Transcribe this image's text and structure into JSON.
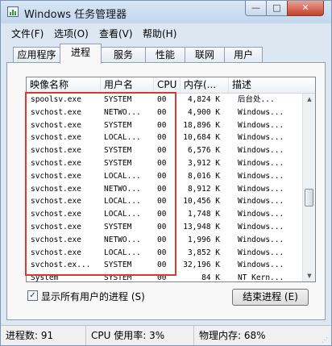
{
  "window": {
    "title": "Windows 任务管理器"
  },
  "title_buttons": {
    "minimize": "—",
    "maximize": "□",
    "close": "✕"
  },
  "menu": [
    "文件(F)",
    "选项(O)",
    "查看(V)",
    "帮助(H)"
  ],
  "tabs": [
    "应用程序",
    "进程",
    "服务",
    "性能",
    "联网",
    "用户"
  ],
  "active_tab": "进程",
  "columns": [
    "映像名称",
    "用户名",
    "CPU",
    "内存(...",
    "描述"
  ],
  "processes": [
    {
      "name": "spoolsv.exe",
      "user": "SYSTEM",
      "cpu": "00",
      "mem": "4,824 K",
      "desc": "后台处..."
    },
    {
      "name": "svchost.exe",
      "user": "NETWO...",
      "cpu": "00",
      "mem": "4,900 K",
      "desc": "Windows..."
    },
    {
      "name": "svchost.exe",
      "user": "SYSTEM",
      "cpu": "00",
      "mem": "18,896 K",
      "desc": "Windows..."
    },
    {
      "name": "svchost.exe",
      "user": "LOCAL...",
      "cpu": "00",
      "mem": "10,684 K",
      "desc": "Windows..."
    },
    {
      "name": "svchost.exe",
      "user": "SYSTEM",
      "cpu": "00",
      "mem": "6,576 K",
      "desc": "Windows..."
    },
    {
      "name": "svchost.exe",
      "user": "SYSTEM",
      "cpu": "00",
      "mem": "3,912 K",
      "desc": "Windows..."
    },
    {
      "name": "svchost.exe",
      "user": "LOCAL...",
      "cpu": "00",
      "mem": "8,016 K",
      "desc": "Windows..."
    },
    {
      "name": "svchost.exe",
      "user": "NETWO...",
      "cpu": "00",
      "mem": "8,912 K",
      "desc": "Windows..."
    },
    {
      "name": "svchost.exe",
      "user": "LOCAL...",
      "cpu": "00",
      "mem": "10,456 K",
      "desc": "Windows..."
    },
    {
      "name": "svchost.exe",
      "user": "LOCAL...",
      "cpu": "00",
      "mem": "1,748 K",
      "desc": "Windows..."
    },
    {
      "name": "svchost.exe",
      "user": "SYSTEM",
      "cpu": "00",
      "mem": "13,948 K",
      "desc": "Windows..."
    },
    {
      "name": "svchost.exe",
      "user": "NETWO...",
      "cpu": "00",
      "mem": "1,996 K",
      "desc": "Windows..."
    },
    {
      "name": "svchost.exe",
      "user": "LOCAL...",
      "cpu": "00",
      "mem": "3,852 K",
      "desc": "Windows..."
    },
    {
      "name": "svchost.ex...",
      "user": "SYSTEM",
      "cpu": "00",
      "mem": "32,196 K",
      "desc": "Windows..."
    },
    {
      "name": "System",
      "user": "SYSTEM",
      "cpu": "00",
      "mem": "84 K",
      "desc": "NT Kern..."
    }
  ],
  "show_all_users": {
    "label": "显示所有用户的进程 (S)",
    "checked": true,
    "mark": "✓"
  },
  "end_process_button": "结束进程 (E)",
  "status": {
    "processes": "进程数: 91",
    "cpu": "CPU 使用率: 3%",
    "memory": "物理内存: 68%"
  },
  "colors": {
    "highlight": "#d9392e",
    "chrome": "#dce7f2"
  }
}
